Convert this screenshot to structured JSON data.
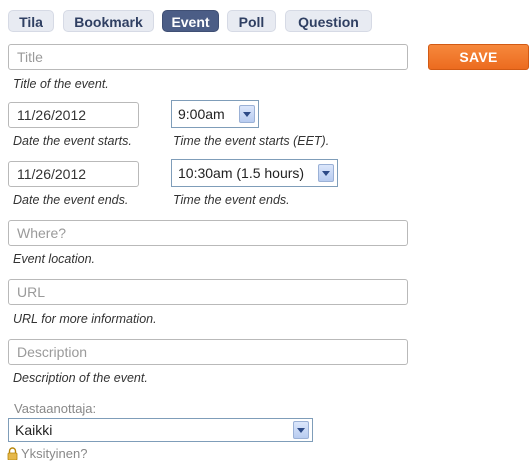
{
  "tabs": [
    {
      "label": "Tila"
    },
    {
      "label": "Bookmark"
    },
    {
      "label": "Event",
      "active": true
    },
    {
      "label": "Poll"
    },
    {
      "label": "Question"
    }
  ],
  "save_label": "SAVE",
  "title_field": {
    "placeholder": "Title",
    "help": "Title of the event."
  },
  "start_date": {
    "value": "11/26/2012",
    "help": "Date the event starts."
  },
  "start_time": {
    "value": "9:00am",
    "help": "Time the event starts (EET)."
  },
  "end_date": {
    "value": "11/26/2012",
    "help": "Date the event ends."
  },
  "end_time": {
    "value": "10:30am (1.5 hours)",
    "help": "Time the event ends."
  },
  "location": {
    "placeholder": "Where?",
    "help": "Event location."
  },
  "url": {
    "placeholder": "URL",
    "help": "URL for more information."
  },
  "description": {
    "placeholder": "Description",
    "help": "Description of the event."
  },
  "recipient": {
    "label": "Vastaanottaja:",
    "value": "Kaikki"
  },
  "private_label": "Yksityinen?",
  "colors": {
    "accent_orange": "#f07a2c",
    "active_tab": "#4b5d86",
    "tab_bg": "#e8ebf2"
  },
  "icons": {
    "dropdown": "chevron-down-icon",
    "private": "lock-icon"
  }
}
